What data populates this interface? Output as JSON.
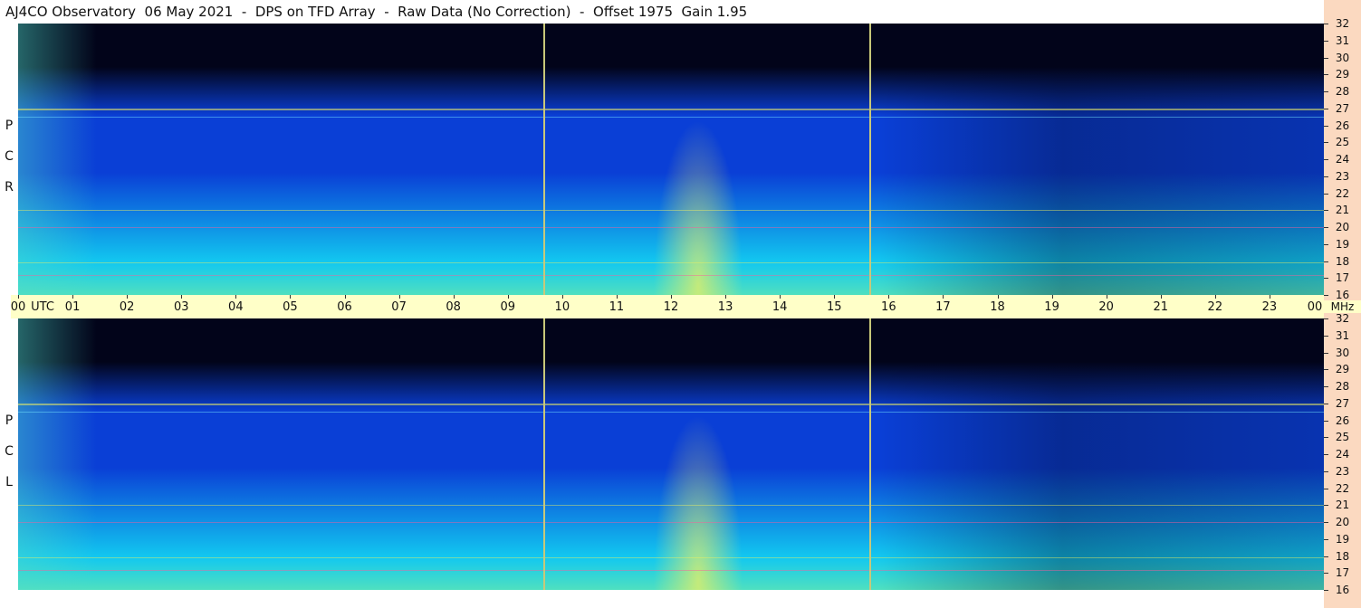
{
  "title": "AJ4CO Observatory  06 May 2021  -  DPS on TFD Array  -  Raw Data (No Correction)  -  Offset 1975  Gain 1.95",
  "chart_data": {
    "type": "heatmap",
    "title": "AJ4CO Observatory  06 May 2021  -  DPS on TFD Array  -  Raw Data (No Correction)  -  Offset 1975  Gain 1.95",
    "panels": [
      {
        "name": "RCP",
        "label_letters": [
          "P",
          "C",
          "R"
        ]
      },
      {
        "name": "LCP",
        "label_letters": [
          "P",
          "C",
          "L"
        ]
      }
    ],
    "x_axis": {
      "unit_label": "UTC",
      "ticks": [
        "00",
        "01",
        "02",
        "03",
        "04",
        "05",
        "06",
        "07",
        "08",
        "09",
        "10",
        "11",
        "12",
        "13",
        "14",
        "15",
        "16",
        "17",
        "18",
        "19",
        "20",
        "21",
        "22",
        "23",
        "00"
      ],
      "range_hours": [
        0,
        24
      ]
    },
    "y_axis": {
      "unit_label": "MHz",
      "ticks": [
        16,
        17,
        18,
        19,
        20,
        21,
        22,
        23,
        24,
        25,
        26,
        27,
        28,
        29,
        30,
        31,
        32
      ],
      "range_mhz": [
        16,
        32
      ]
    },
    "time_markers_hours": [
      9.65,
      15.65
    ],
    "interference_bands_mhz": [
      27.0,
      17.2,
      17.9,
      21.0,
      20.0,
      26.5
    ],
    "colors": {
      "low": "#02041a",
      "mid": "#0a3fd6",
      "high": "#12c8f0",
      "peak": "#f0f060",
      "axis_bg": "#ffffc8",
      "mhz_bg": "#fbd9c0"
    }
  }
}
